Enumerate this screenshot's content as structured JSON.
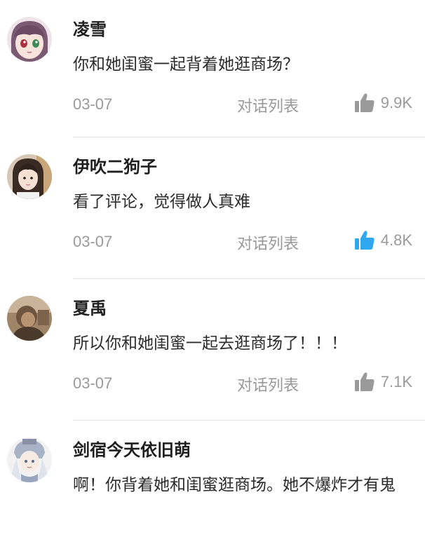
{
  "comments": [
    {
      "username": "凌雪",
      "content": "你和她闺蜜一起背着她逛商场？",
      "date": "03-07",
      "thread_label": "对话列表",
      "likes": "9.9K",
      "liked": false
    },
    {
      "username": "伊吹二狗子",
      "content": "看了评论，觉得做人真难",
      "date": "03-07",
      "thread_label": "对话列表",
      "likes": "4.8K",
      "liked": true
    },
    {
      "username": "夏禹",
      "content": "所以你和她闺蜜一起去逛商场了！！！",
      "date": "03-07",
      "thread_label": "对话列表",
      "likes": "7.1K",
      "liked": false
    },
    {
      "username": "剑宿今天依旧萌",
      "content": "啊！你背着她和闺蜜逛商场。她不爆炸才有鬼"
    }
  ],
  "colors": {
    "like_inactive": "#9a9a9a",
    "like_active": "#2fa8f0",
    "divider": "#e3e3e3",
    "meta_text": "#9a9a9a"
  }
}
